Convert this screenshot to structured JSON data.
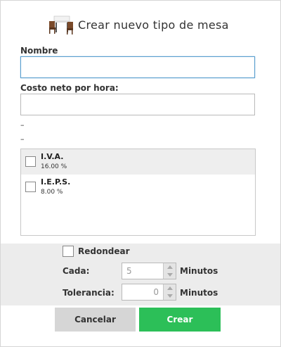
{
  "dialog": {
    "title": "Crear nuevo tipo de mesa",
    "icon": "table-chairs-icon"
  },
  "form": {
    "name_label": "Nombre",
    "name_value": "",
    "cost_label": "Costo neto por hora:",
    "cost_value": "",
    "dash_1": "–",
    "dash_2": "–"
  },
  "taxes": [
    {
      "name": "I.V.A.",
      "rate": "16.00 %",
      "checked": false
    },
    {
      "name": "I.E.P.S.",
      "rate": "8.00 %",
      "checked": false
    }
  ],
  "rounding": {
    "label": "Redondear",
    "checked": false,
    "cada_label": "Cada:",
    "cada_value": "5",
    "tolerancia_label": "Tolerancia:",
    "tolerancia_value": "0",
    "unit": "Minutos"
  },
  "buttons": {
    "cancel": "Cancelar",
    "create": "Crear"
  },
  "colors": {
    "create_button": "#2cbf58",
    "cancel_button": "#d6d6d6",
    "focus_border": "#5b9fcf"
  }
}
